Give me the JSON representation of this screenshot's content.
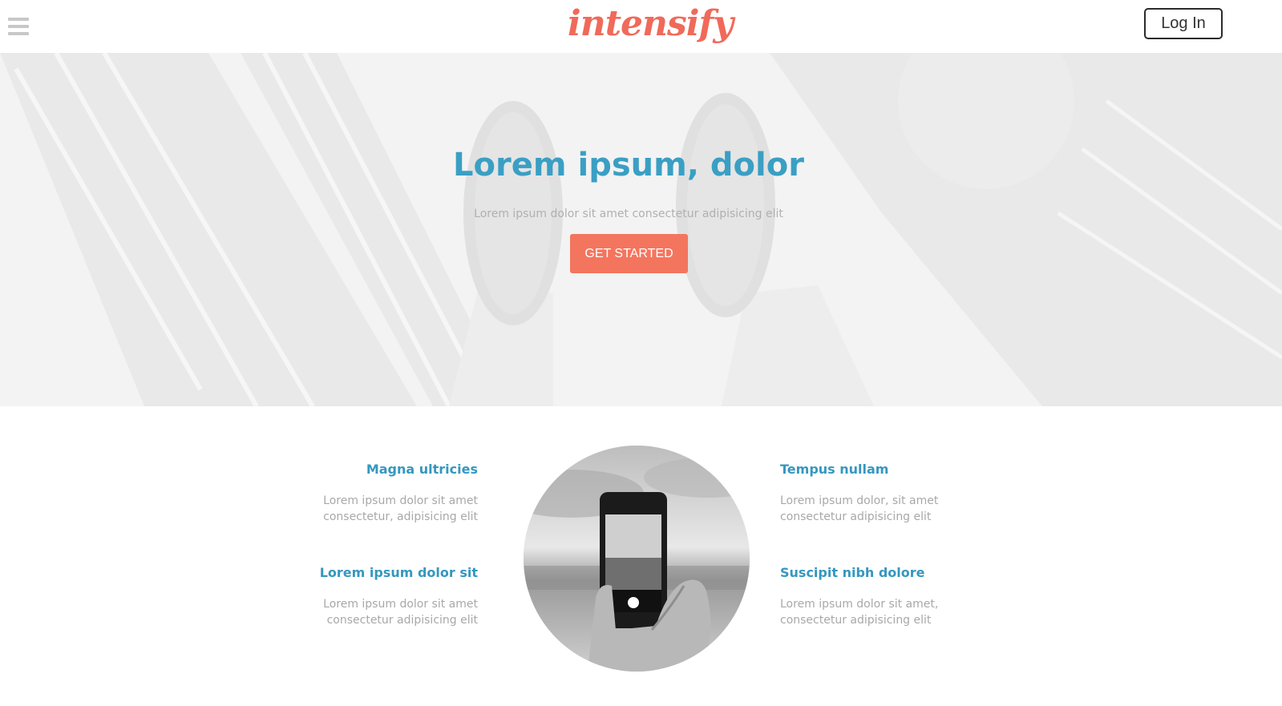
{
  "header": {
    "logo_text": "intensify",
    "login_label": "Log In"
  },
  "hero": {
    "title": "Lorem ipsum, dolor",
    "subtitle": "Lorem ipsum dolor sit amet consectetur adipisicing elit",
    "cta_label": "GET STARTED"
  },
  "features": {
    "left": [
      {
        "title": "Magna ultricies",
        "text": "Lorem ipsum dolor sit amet consectetur, adipisicing elit"
      },
      {
        "title": "Lorem ipsum dolor sit",
        "text": "Lorem ipsum dolor sit amet consectetur adipisicing elit"
      }
    ],
    "right": [
      {
        "title": "Tempus nullam",
        "text": "Lorem ipsum dolor, sit amet consectetur adipisicing elit"
      },
      {
        "title": "Suscipit nibh dolore",
        "text": "Lorem ipsum dolor sit amet, consectetur adipisicing elit"
      }
    ]
  },
  "colors": {
    "brand": "#f06a5a",
    "cta": "#f4755e",
    "heading": "#3a9fc4"
  },
  "icons": {
    "menu": "hamburger-icon"
  }
}
